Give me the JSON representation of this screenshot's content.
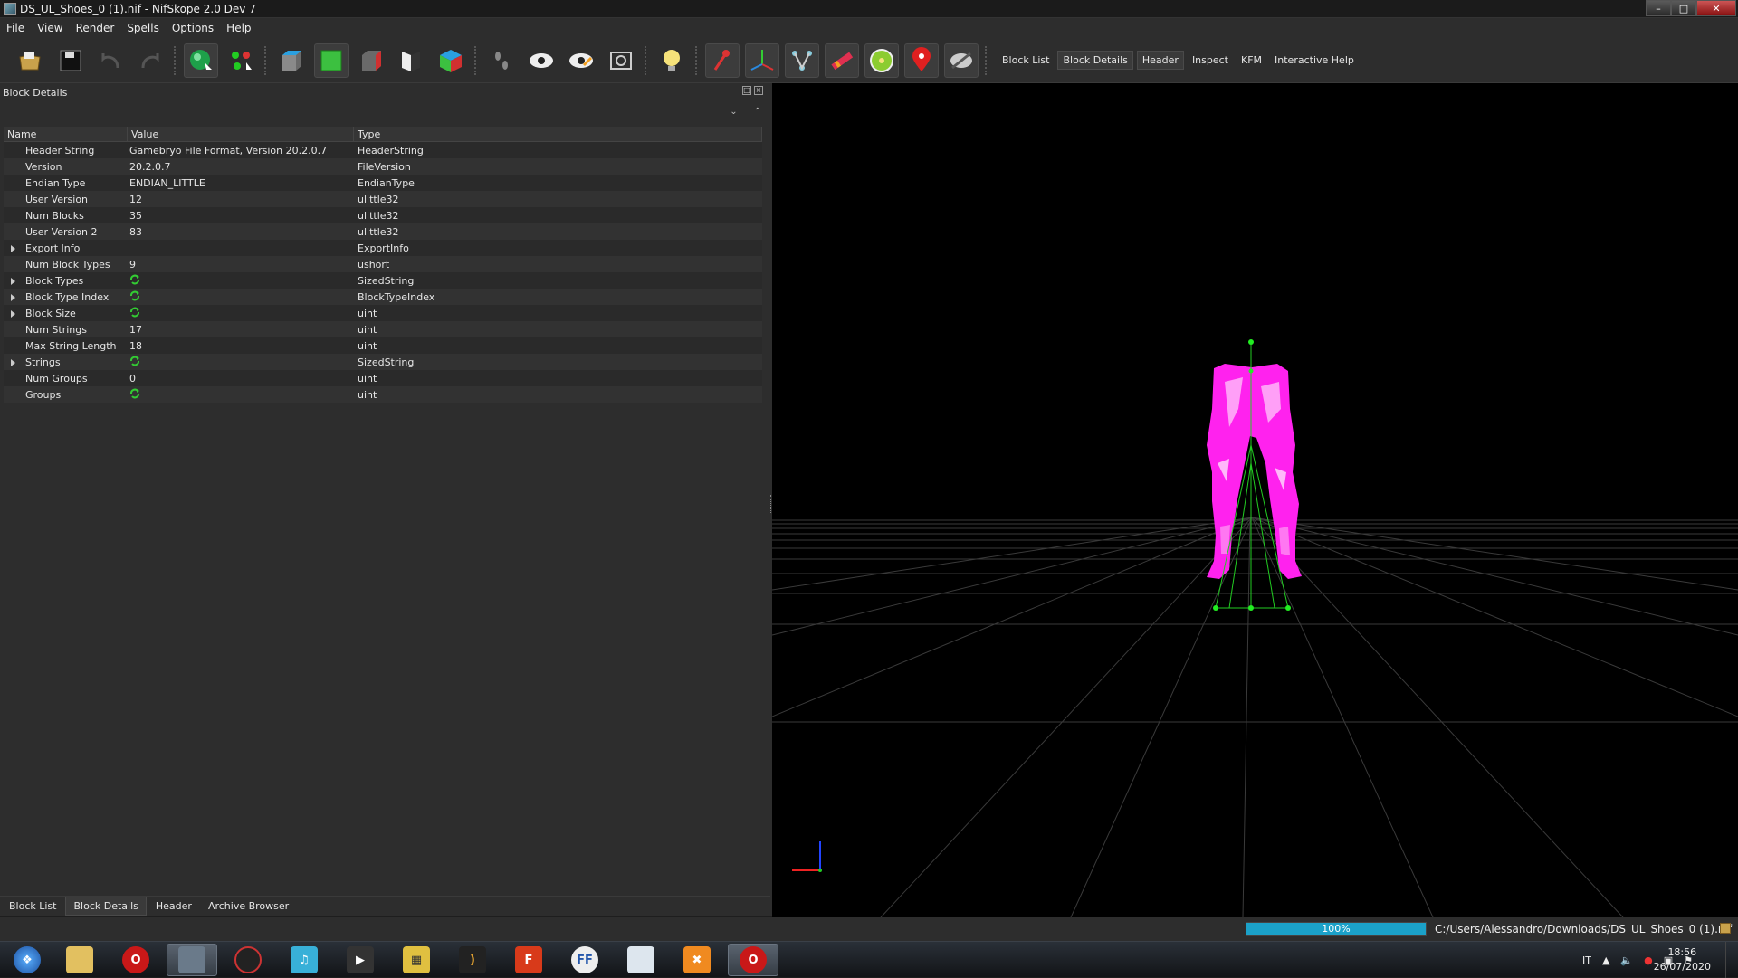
{
  "window": {
    "title": "DS_UL_Shoes_0 (1).nif - NifSkope 2.0 Dev 7"
  },
  "menu": [
    "File",
    "View",
    "Render",
    "Spells",
    "Options",
    "Help"
  ],
  "toolbar": {
    "links": [
      "Block List",
      "Block Details",
      "Header",
      "Inspect",
      "KFM",
      "Interactive Help"
    ],
    "active_link": "Block Details"
  },
  "dock": {
    "title": "Block Details",
    "columns": [
      "Name",
      "Value",
      "Type"
    ],
    "rows": [
      {
        "name": "Header String",
        "value": "Gamebryo File Format, Version 20.2.0.7",
        "type": "HeaderString",
        "expandable": false,
        "icon": false
      },
      {
        "name": "Version",
        "value": "20.2.0.7",
        "type": "FileVersion",
        "expandable": false,
        "icon": false
      },
      {
        "name": "Endian Type",
        "value": "ENDIAN_LITTLE",
        "type": "EndianType",
        "expandable": false,
        "icon": false
      },
      {
        "name": "User Version",
        "value": "12",
        "type": "ulittle32",
        "expandable": false,
        "icon": false
      },
      {
        "name": "Num Blocks",
        "value": "35",
        "type": "ulittle32",
        "expandable": false,
        "icon": false
      },
      {
        "name": "User Version 2",
        "value": "83",
        "type": "ulittle32",
        "expandable": false,
        "icon": false
      },
      {
        "name": "Export Info",
        "value": "",
        "type": "ExportInfo",
        "expandable": true,
        "icon": false
      },
      {
        "name": "Num Block Types",
        "value": "9",
        "type": "ushort",
        "expandable": false,
        "icon": false
      },
      {
        "name": "Block Types",
        "value": "",
        "type": "SizedString",
        "expandable": true,
        "icon": true
      },
      {
        "name": "Block Type Index",
        "value": "",
        "type": "BlockTypeIndex",
        "expandable": true,
        "icon": true
      },
      {
        "name": "Block Size",
        "value": "",
        "type": "uint",
        "expandable": true,
        "icon": true
      },
      {
        "name": "Num Strings",
        "value": "17",
        "type": "uint",
        "expandable": false,
        "icon": false
      },
      {
        "name": "Max String Length",
        "value": "18",
        "type": "uint",
        "expandable": false,
        "icon": false
      },
      {
        "name": "Strings",
        "value": "",
        "type": "SizedString",
        "expandable": true,
        "icon": true
      },
      {
        "name": "Num Groups",
        "value": "0",
        "type": "uint",
        "expandable": false,
        "icon": false
      },
      {
        "name": "Groups",
        "value": "",
        "type": "uint",
        "expandable": false,
        "icon": true
      }
    ]
  },
  "bottom_tabs": [
    "Block List",
    "Block Details",
    "Header",
    "Archive Browser"
  ],
  "active_bottom_tab": "Block Details",
  "status": {
    "progress_label": "100%",
    "progress_fraction": 1.0,
    "path": "C:/Users/Alessandro/Downloads/DS_UL_Shoes_0 (1).nif"
  },
  "taskbar": {
    "language": "IT",
    "time": "18:56",
    "date": "26/07/2020"
  },
  "colors": {
    "mesh": "#ff22ee",
    "bone": "#22cc22",
    "progress": "#1ba1c8"
  }
}
